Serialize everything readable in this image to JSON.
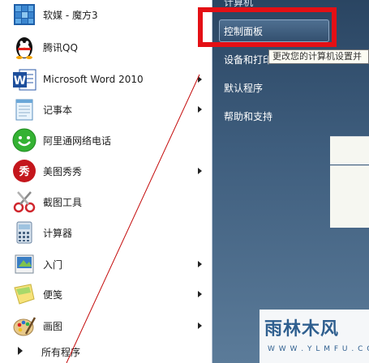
{
  "menu": {
    "items": [
      {
        "label": "软媒 - 魔方3",
        "icon": "cube-icon",
        "has_submenu": false
      },
      {
        "label": "腾讯QQ",
        "icon": "penguin-icon",
        "has_submenu": false
      },
      {
        "label": "Microsoft Word 2010",
        "icon": "word-icon",
        "has_submenu": true
      },
      {
        "label": "记事本",
        "icon": "notepad-icon",
        "has_submenu": true
      },
      {
        "label": "阿里通网络电话",
        "icon": "smiley-phone-icon",
        "has_submenu": false
      },
      {
        "label": "美图秀秀",
        "icon": "meitu-icon",
        "has_submenu": true
      },
      {
        "label": "截图工具",
        "icon": "scissors-icon",
        "has_submenu": false
      },
      {
        "label": "计算器",
        "icon": "calculator-icon",
        "has_submenu": false
      },
      {
        "label": "入门",
        "icon": "getting-started-icon",
        "has_submenu": true
      },
      {
        "label": "便笺",
        "icon": "sticky-note-icon",
        "has_submenu": true
      },
      {
        "label": "画图",
        "icon": "paint-icon",
        "has_submenu": true
      }
    ],
    "all_programs": "所有程序"
  },
  "right_panel": {
    "top_partial": "计算机",
    "control_panel": "控制面板",
    "devices_printers": "设备和打印",
    "default_programs": "默认程序",
    "help_support": "帮助和支持"
  },
  "tooltip": "更改您的计算机设置并",
  "watermark": {
    "title": "雨林木风",
    "url": "W W W . Y L M F U . C O M"
  },
  "colors": {
    "highlight_box": "#e41015",
    "right_panel": "#3e5d7d"
  }
}
